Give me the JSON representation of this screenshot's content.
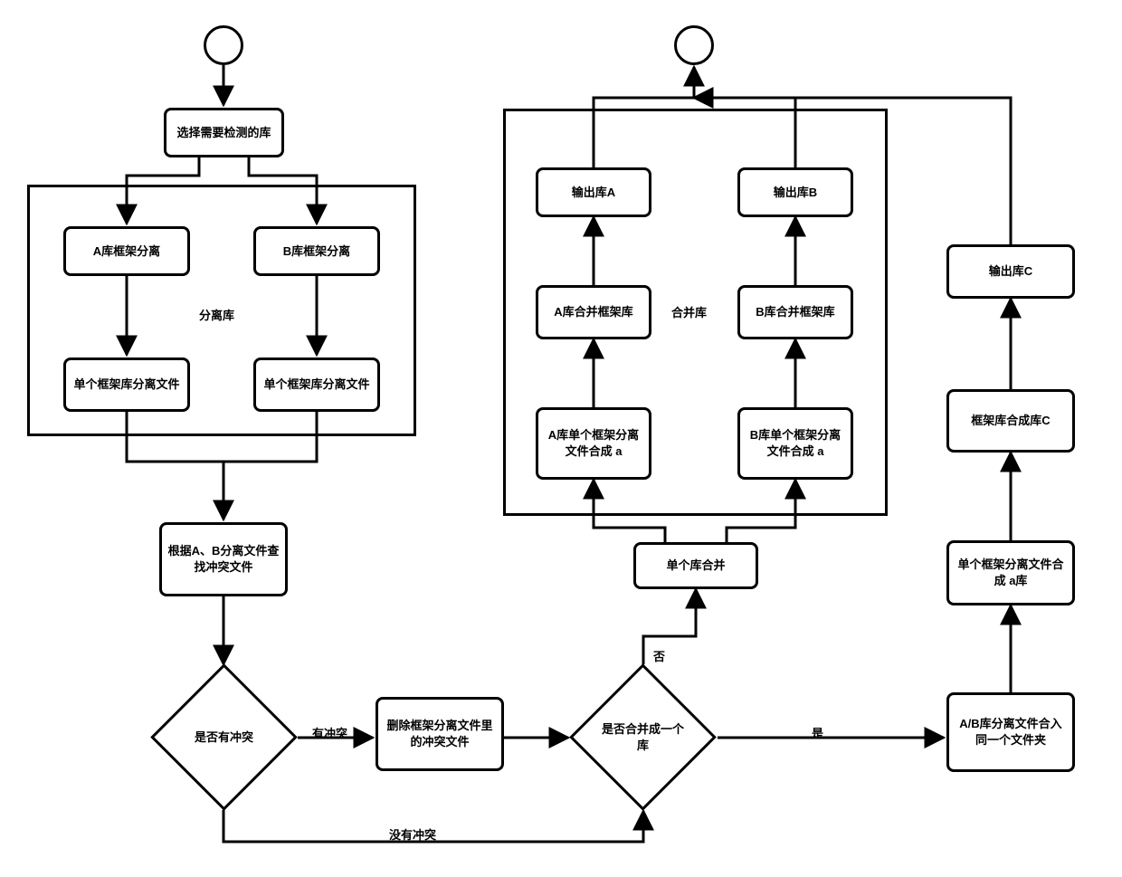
{
  "start1": "",
  "end1": "",
  "b_select": "选择需要检测的库",
  "c1_label": "分离库",
  "b_a_split": "A库框架分离",
  "b_b_split": "B库框架分离",
  "b_a_file": "单个框架库分离文件",
  "b_b_file": "单个框架库分离文件",
  "b_find": "根据A、B分离文件查找冲突文件",
  "d_conflict": "是否有冲突",
  "e_has": "有冲突",
  "e_none": "没有冲突",
  "b_delete": "删除框架分离文件里的冲突文件",
  "d_merge": "是否合并成一个库",
  "e_no": "否",
  "e_yes": "是",
  "b_single_merge": "单个库合并",
  "c2_label": "合并库",
  "b_a_comp": "A库单个框架分离文件合成 a",
  "b_b_comp": "B库单个框架分离文件合成 a",
  "b_a_mfw": "A库合并框架库",
  "b_b_mfw": "B库合并框架库",
  "b_out_a": "输出库A",
  "b_out_b": "输出库B",
  "b_ab_folder": "A/B库分离文件合入同一个文件夹",
  "b_single_a": "单个框架分离文件合成 a库",
  "b_fw_c": "框架库合成库C",
  "b_out_c": "输出库C"
}
